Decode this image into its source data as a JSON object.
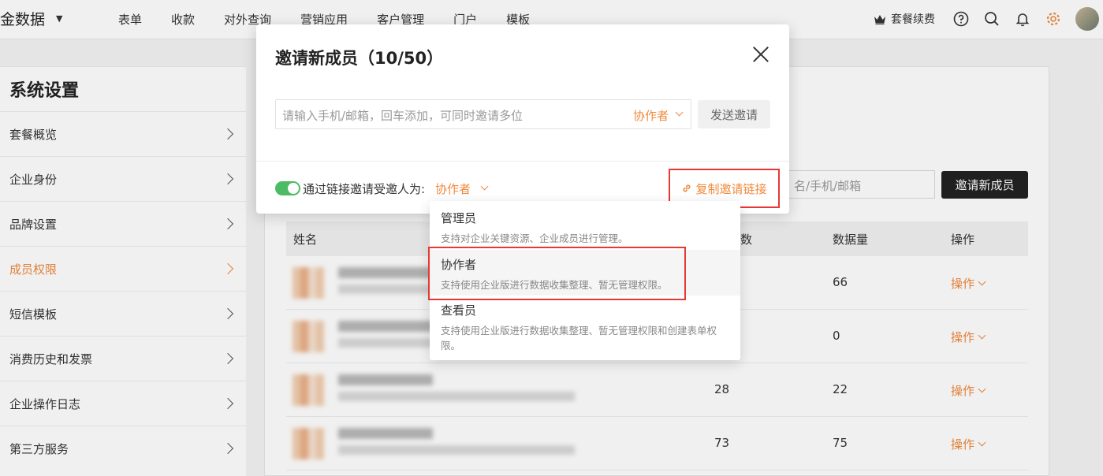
{
  "topbar": {
    "brand": "金数据",
    "nav": [
      "表单",
      "收款",
      "对外查询",
      "营销应用",
      "客户管理",
      "门户",
      "模板"
    ],
    "renew_label": "套餐续费",
    "icons": [
      "help-icon",
      "search-icon",
      "bell-icon",
      "gear-icon"
    ]
  },
  "sidebar": {
    "title": "系统设置",
    "items": [
      {
        "label": "套餐概览"
      },
      {
        "label": "企业身份"
      },
      {
        "label": "品牌设置"
      },
      {
        "label": "成员权限",
        "active": true
      },
      {
        "label": "短信模板"
      },
      {
        "label": "消费历史和发票"
      },
      {
        "label": "企业操作日志"
      },
      {
        "label": "第三方服务"
      }
    ]
  },
  "main": {
    "search_placeholder": "名/手机/邮箱",
    "invite_button": "邀请新成员",
    "columns": {
      "name": "姓名",
      "count": "数",
      "data_volume": "数据量",
      "action": "操作"
    },
    "rows": [
      {
        "count": "",
        "data_volume": "66",
        "action": "操作"
      },
      {
        "count": "",
        "data_volume": "0",
        "action": "操作"
      },
      {
        "count": "28",
        "data_volume": "22",
        "action": "操作"
      },
      {
        "count": "73",
        "data_volume": "75",
        "action": "操作"
      }
    ]
  },
  "modal": {
    "title": "邀请新成员（10/50）",
    "input_placeholder": "请输入手机/邮箱，回车添加，可同时邀请多位",
    "input_role": "协作者",
    "send_button": "发送邀请",
    "link_toggle_on": true,
    "link_label": "通过链接邀请受邀人为:",
    "link_role": "协作者",
    "copy_link": "复制邀请链接"
  },
  "dropdown": {
    "options": [
      {
        "title": "管理员",
        "desc": "支持对企业关键资源、企业成员进行管理。"
      },
      {
        "title": "协作者",
        "desc": "支持使用企业版进行数据收集整理、暂无管理权限。",
        "selected": true
      },
      {
        "title": "查看员",
        "desc": "支持使用企业版进行数据收集整理、暂无管理权限和创建表单权限。"
      }
    ]
  },
  "colors": {
    "accent": "#f08a3e",
    "highlight": "#e53935",
    "toggle": "#4cbb64"
  }
}
